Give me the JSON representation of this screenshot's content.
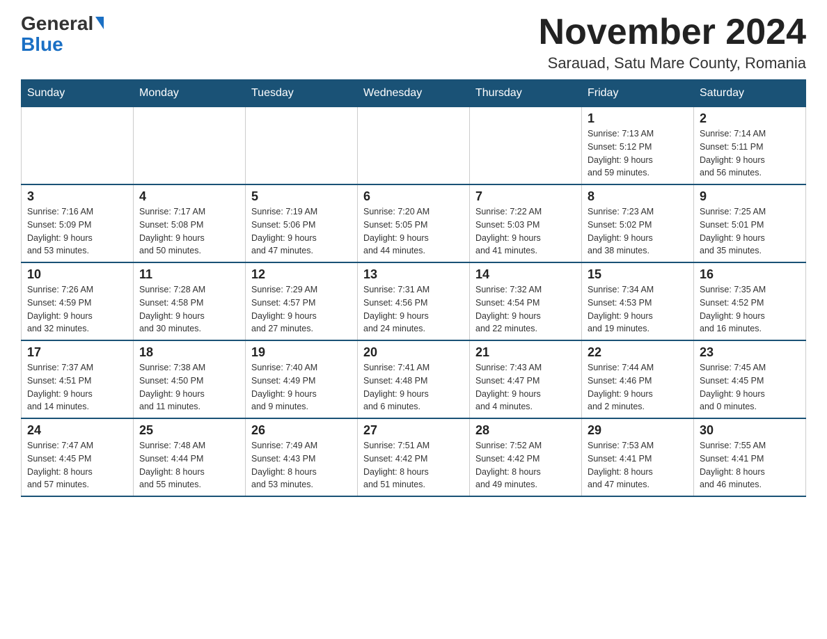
{
  "header": {
    "logo_general": "General",
    "logo_blue": "Blue",
    "month_title": "November 2024",
    "location": "Sarauad, Satu Mare County, Romania"
  },
  "days_of_week": [
    "Sunday",
    "Monday",
    "Tuesday",
    "Wednesday",
    "Thursday",
    "Friday",
    "Saturday"
  ],
  "weeks": [
    [
      {
        "day": "",
        "info": ""
      },
      {
        "day": "",
        "info": ""
      },
      {
        "day": "",
        "info": ""
      },
      {
        "day": "",
        "info": ""
      },
      {
        "day": "",
        "info": ""
      },
      {
        "day": "1",
        "info": "Sunrise: 7:13 AM\nSunset: 5:12 PM\nDaylight: 9 hours\nand 59 minutes."
      },
      {
        "day": "2",
        "info": "Sunrise: 7:14 AM\nSunset: 5:11 PM\nDaylight: 9 hours\nand 56 minutes."
      }
    ],
    [
      {
        "day": "3",
        "info": "Sunrise: 7:16 AM\nSunset: 5:09 PM\nDaylight: 9 hours\nand 53 minutes."
      },
      {
        "day": "4",
        "info": "Sunrise: 7:17 AM\nSunset: 5:08 PM\nDaylight: 9 hours\nand 50 minutes."
      },
      {
        "day": "5",
        "info": "Sunrise: 7:19 AM\nSunset: 5:06 PM\nDaylight: 9 hours\nand 47 minutes."
      },
      {
        "day": "6",
        "info": "Sunrise: 7:20 AM\nSunset: 5:05 PM\nDaylight: 9 hours\nand 44 minutes."
      },
      {
        "day": "7",
        "info": "Sunrise: 7:22 AM\nSunset: 5:03 PM\nDaylight: 9 hours\nand 41 minutes."
      },
      {
        "day": "8",
        "info": "Sunrise: 7:23 AM\nSunset: 5:02 PM\nDaylight: 9 hours\nand 38 minutes."
      },
      {
        "day": "9",
        "info": "Sunrise: 7:25 AM\nSunset: 5:01 PM\nDaylight: 9 hours\nand 35 minutes."
      }
    ],
    [
      {
        "day": "10",
        "info": "Sunrise: 7:26 AM\nSunset: 4:59 PM\nDaylight: 9 hours\nand 32 minutes."
      },
      {
        "day": "11",
        "info": "Sunrise: 7:28 AM\nSunset: 4:58 PM\nDaylight: 9 hours\nand 30 minutes."
      },
      {
        "day": "12",
        "info": "Sunrise: 7:29 AM\nSunset: 4:57 PM\nDaylight: 9 hours\nand 27 minutes."
      },
      {
        "day": "13",
        "info": "Sunrise: 7:31 AM\nSunset: 4:56 PM\nDaylight: 9 hours\nand 24 minutes."
      },
      {
        "day": "14",
        "info": "Sunrise: 7:32 AM\nSunset: 4:54 PM\nDaylight: 9 hours\nand 22 minutes."
      },
      {
        "day": "15",
        "info": "Sunrise: 7:34 AM\nSunset: 4:53 PM\nDaylight: 9 hours\nand 19 minutes."
      },
      {
        "day": "16",
        "info": "Sunrise: 7:35 AM\nSunset: 4:52 PM\nDaylight: 9 hours\nand 16 minutes."
      }
    ],
    [
      {
        "day": "17",
        "info": "Sunrise: 7:37 AM\nSunset: 4:51 PM\nDaylight: 9 hours\nand 14 minutes."
      },
      {
        "day": "18",
        "info": "Sunrise: 7:38 AM\nSunset: 4:50 PM\nDaylight: 9 hours\nand 11 minutes."
      },
      {
        "day": "19",
        "info": "Sunrise: 7:40 AM\nSunset: 4:49 PM\nDaylight: 9 hours\nand 9 minutes."
      },
      {
        "day": "20",
        "info": "Sunrise: 7:41 AM\nSunset: 4:48 PM\nDaylight: 9 hours\nand 6 minutes."
      },
      {
        "day": "21",
        "info": "Sunrise: 7:43 AM\nSunset: 4:47 PM\nDaylight: 9 hours\nand 4 minutes."
      },
      {
        "day": "22",
        "info": "Sunrise: 7:44 AM\nSunset: 4:46 PM\nDaylight: 9 hours\nand 2 minutes."
      },
      {
        "day": "23",
        "info": "Sunrise: 7:45 AM\nSunset: 4:45 PM\nDaylight: 9 hours\nand 0 minutes."
      }
    ],
    [
      {
        "day": "24",
        "info": "Sunrise: 7:47 AM\nSunset: 4:45 PM\nDaylight: 8 hours\nand 57 minutes."
      },
      {
        "day": "25",
        "info": "Sunrise: 7:48 AM\nSunset: 4:44 PM\nDaylight: 8 hours\nand 55 minutes."
      },
      {
        "day": "26",
        "info": "Sunrise: 7:49 AM\nSunset: 4:43 PM\nDaylight: 8 hours\nand 53 minutes."
      },
      {
        "day": "27",
        "info": "Sunrise: 7:51 AM\nSunset: 4:42 PM\nDaylight: 8 hours\nand 51 minutes."
      },
      {
        "day": "28",
        "info": "Sunrise: 7:52 AM\nSunset: 4:42 PM\nDaylight: 8 hours\nand 49 minutes."
      },
      {
        "day": "29",
        "info": "Sunrise: 7:53 AM\nSunset: 4:41 PM\nDaylight: 8 hours\nand 47 minutes."
      },
      {
        "day": "30",
        "info": "Sunrise: 7:55 AM\nSunset: 4:41 PM\nDaylight: 8 hours\nand 46 minutes."
      }
    ]
  ]
}
